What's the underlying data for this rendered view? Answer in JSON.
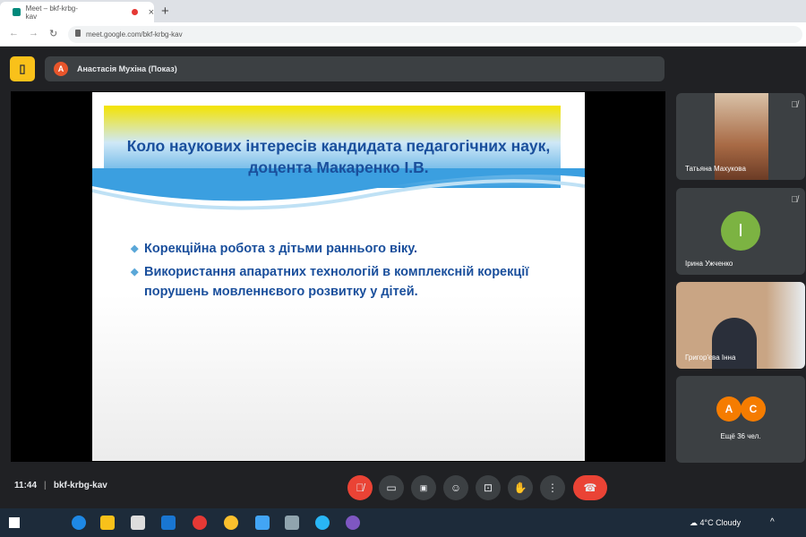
{
  "browser": {
    "tab_title": "Meet – bkf-krbg-kav",
    "url": "meet.google.com/bkf-krbg-kav",
    "new_tab": "+",
    "close": "×"
  },
  "header": {
    "presenter_initial": "А",
    "presenter": "Анастасія Мухіна (Показ)"
  },
  "slide": {
    "title": "Коло наукових інтересів кандидата педагогічних наук, доцента Макаренко І.В.",
    "bullets": [
      "Корекційна робота з дітьми раннього віку.",
      "Використання апаратних технологій в комплексній корекції порушень мовленнєвого розвитку у дітей."
    ]
  },
  "participants": [
    {
      "name": "Татьяна Махукова"
    },
    {
      "name": "Ірина Ужченко",
      "initial": "І",
      "color": "#7cb342"
    },
    {
      "name": "Григор'єва Інна"
    }
  ],
  "more": {
    "initials": [
      "А",
      "С"
    ],
    "label": "Ещё 36 чел.",
    "color": "#f57c00"
  },
  "footer": {
    "time": "11:44",
    "meeting_code": "bkf-krbg-kav"
  },
  "taskbar": {
    "weather": "4°C  Cloudy"
  }
}
